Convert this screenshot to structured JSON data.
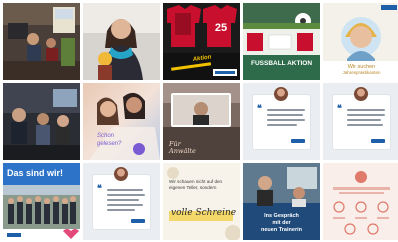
{
  "colors": {
    "brand_blue": "#1d5fa8",
    "soccer_red": "#c8102e",
    "aktion_green": "#2d6b4b",
    "highlight_yellow": "#f2c200"
  },
  "posts": {
    "p3": {
      "jersey_number": "25",
      "banner": "Aktion"
    },
    "p4": {
      "title": "FUSSBALL AKTION"
    },
    "p5": {
      "line1": "Wir suchen",
      "line2": "Jahrespraktikanten"
    },
    "p7": {
      "line1": "Schon",
      "line2": "gelesen?"
    },
    "p8": {
      "caption": "Für Anwälte"
    },
    "p11": {
      "title": "Das sind wir!"
    },
    "p13": {
      "line1": "Wir schauen nicht auf den",
      "line2": "eigenen Teller, sondern",
      "highlight": "volle Schreine"
    },
    "p14": {
      "line1": "Ins Gespräch",
      "line2": "mit der",
      "line3": "neuen Trainerin"
    }
  }
}
